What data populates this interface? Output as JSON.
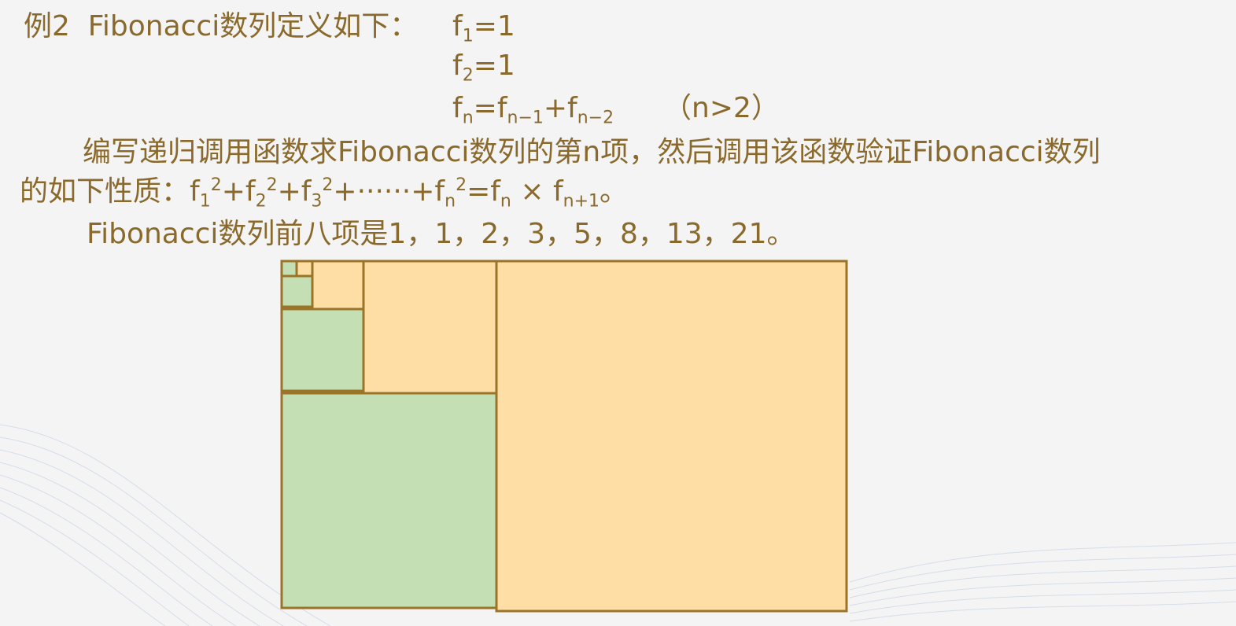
{
  "slide": {
    "title_prefix": "例2",
    "title_text": "Fibonacci数列定义如下：",
    "def1": {
      "base": "f",
      "sub": "1",
      "rest": "=1"
    },
    "def2": {
      "base": "f",
      "sub": "2",
      "rest": "=1"
    },
    "def3": {
      "lhs_base": "f",
      "lhs_sub": "n",
      "eq": "=",
      "t1_base": "f",
      "t1_sub": "n−1",
      "plus": "+",
      "t2_base": "f",
      "t2_sub": "n−2",
      "cond": "（n>2）"
    },
    "para1": "编写递归调用函数求Fibonacci数列的第n项，然后调用该函数验证Fibonacci数列",
    "para2": {
      "prefix": "的如下性质：",
      "f": "f",
      "s1": "1",
      "s2": "2",
      "s3": "3",
      "sn": "n",
      "sn1": "n+1",
      "sq": "2",
      "plus": "+",
      "dots": "+······+",
      "eq": "=",
      "times": " × ",
      "end": "。"
    },
    "para3": "Fibonacci数列前八项是1，1，2，3，5，8，13，21。"
  },
  "colors": {
    "text": "#8a6a2c",
    "square_orange": "#ffdea6",
    "square_green": "#c5dfb4",
    "square_stroke": "#9a7427"
  },
  "figure": {
    "description_values": [
      1,
      1,
      2,
      3,
      5,
      8,
      13,
      21
    ]
  }
}
